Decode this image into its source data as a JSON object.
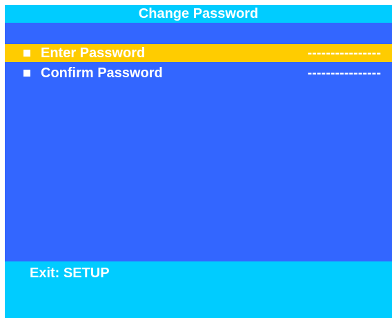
{
  "title": "Change Password",
  "menu": {
    "items": [
      {
        "label": "Enter Password",
        "value": "----------------",
        "selected": true
      },
      {
        "label": "Confirm Password",
        "value": "----------------",
        "selected": false
      }
    ]
  },
  "footer": {
    "hint": "Exit: SETUP"
  },
  "colors": {
    "background": "#3366ff",
    "title_bar": "#00ccff",
    "highlight": "#ffcc00",
    "text": "#ffffff"
  }
}
